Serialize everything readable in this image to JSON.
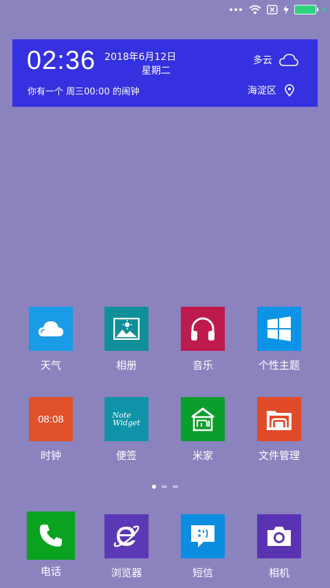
{
  "status_bar": {
    "icons": [
      "more-dots-icon",
      "wifi-icon",
      "no-sim-icon",
      "charging-icon",
      "battery-icon"
    ],
    "battery_color": "#2ed17f"
  },
  "clock_widget": {
    "time": "02:36",
    "date": "2018年6月12日",
    "weekday": "星期二",
    "alarm": "你有一个 周三00:00 的闹钟",
    "weather": "多云",
    "location": "海淀区",
    "background": "#3531e0"
  },
  "apps": [
    {
      "label": "天气",
      "icon": "cloud-icon",
      "color": "#1a9be6"
    },
    {
      "label": "相册",
      "icon": "gallery-icon",
      "color": "#0f8f9a"
    },
    {
      "label": "音乐",
      "icon": "headphones-icon",
      "color": "#bf1a4c"
    },
    {
      "label": "个性主题",
      "icon": "windows-icon",
      "color": "#0b93e6"
    },
    {
      "label": "时钟",
      "icon": "clock-tile-icon",
      "color": "#e0502a",
      "tile_text": "08:08"
    },
    {
      "label": "便签",
      "icon": "note-widget-icon",
      "color": "#0f93a8",
      "tile_text_1": "Note",
      "tile_text_2": "Widget"
    },
    {
      "label": "米家",
      "icon": "mijia-home-icon",
      "color": "#0b9e2c"
    },
    {
      "label": "文件管理",
      "icon": "folder-icon",
      "color": "#e14b2a"
    }
  ],
  "pager": {
    "pages": 3,
    "current": 1
  },
  "dock": [
    {
      "label": "电话",
      "icon": "phone-icon",
      "color": "#0aa31f"
    },
    {
      "label": "浏览器",
      "icon": "browser-icon",
      "color": "#5b38b5"
    },
    {
      "label": "短信",
      "icon": "message-icon",
      "color": "#0b8ee0"
    },
    {
      "label": "相机",
      "icon": "camera-icon",
      "color": "#5a33b3"
    }
  ],
  "wallpaper_color": "#8b83be"
}
